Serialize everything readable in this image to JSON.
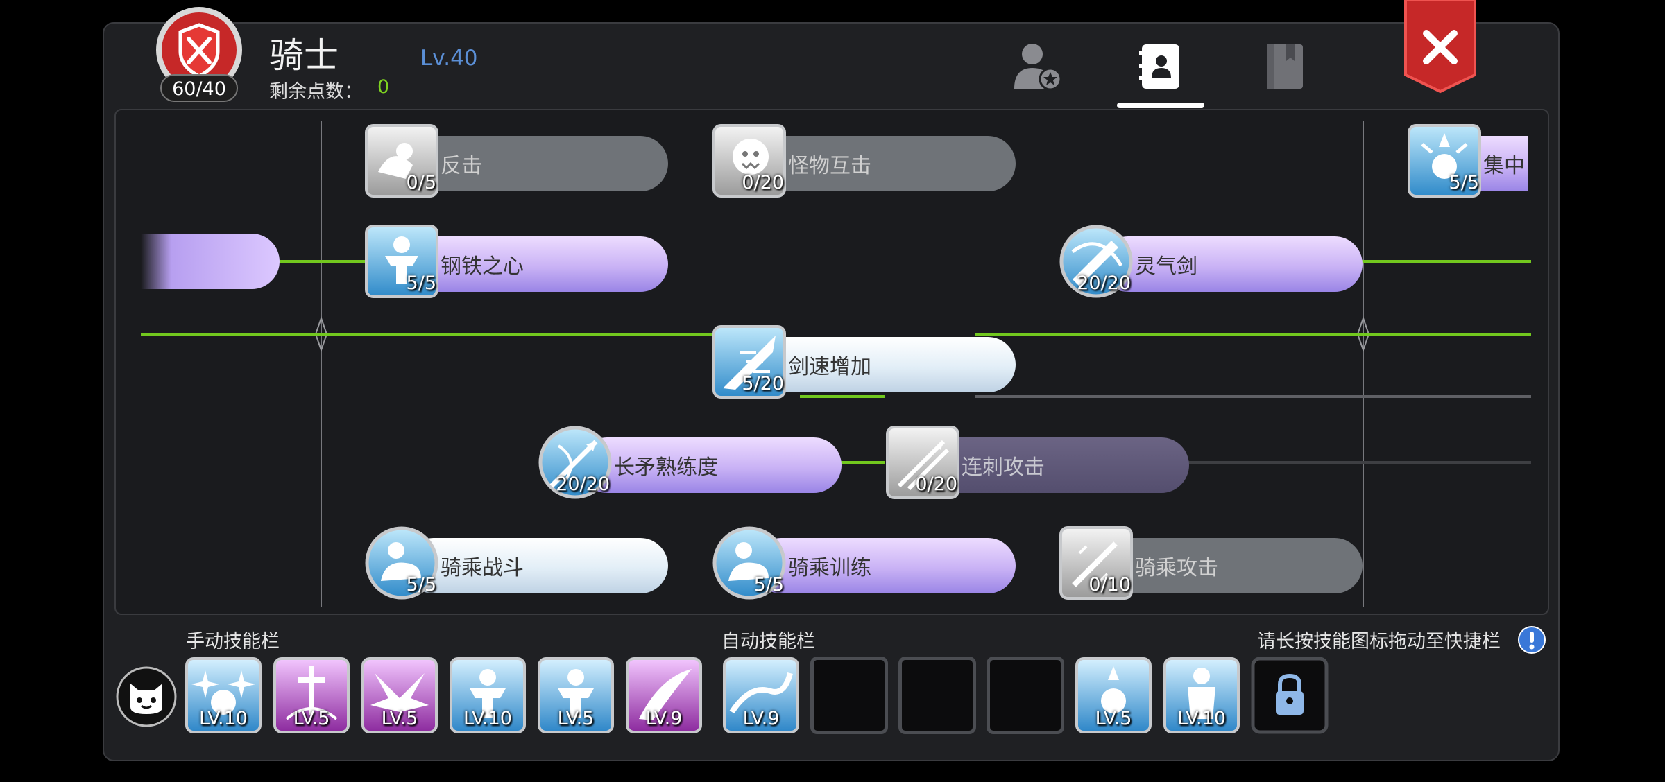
{
  "header": {
    "emblem_value": "60/40",
    "class_name": "骑士",
    "class_level": "Lv.40",
    "points_label": "剩余点数：",
    "points_value": "0",
    "tabs": [
      {
        "name": "character-tab",
        "icon": "person-star-icon",
        "active": false
      },
      {
        "name": "skills-tab",
        "icon": "contact-book-icon",
        "active": true
      },
      {
        "name": "guide-tab",
        "icon": "book-icon",
        "active": false
      }
    ],
    "close_icon": "close-icon"
  },
  "skills": [
    {
      "id": "counter",
      "name": "反击",
      "level": "0/5",
      "style": "gray",
      "icon": "counter-icon"
    },
    {
      "id": "monster",
      "name": "怪物互击",
      "level": "0/20",
      "style": "gray",
      "icon": "monster-icon"
    },
    {
      "id": "focus",
      "name": "集中",
      "level": "5/5",
      "style": "purple",
      "icon": "focus-icon"
    },
    {
      "id": "steel",
      "name": "钢铁之心",
      "level": "5/5",
      "style": "purple",
      "icon": "steel-heart-icon"
    },
    {
      "id": "aura",
      "name": "灵气剑",
      "level": "20/20",
      "style": "purple",
      "icon": "aura-sword-icon"
    },
    {
      "id": "swordspeed",
      "name": "剑速增加",
      "level": "5/20",
      "style": "white",
      "icon": "sword-speed-icon"
    },
    {
      "id": "spear",
      "name": "长矛熟练度",
      "level": "20/20",
      "style": "purple",
      "icon": "spear-mastery-icon"
    },
    {
      "id": "pierce",
      "name": "连刺攻击",
      "level": "0/20",
      "style": "dimpurple",
      "icon": "pierce-icon"
    },
    {
      "id": "ridefight",
      "name": "骑乘战斗",
      "level": "5/5",
      "style": "white",
      "icon": "riding-combat-icon"
    },
    {
      "id": "ridetrain",
      "name": "骑乘训练",
      "level": "5/5",
      "style": "purple",
      "icon": "riding-training-icon"
    },
    {
      "id": "rideattack",
      "name": "骑乘攻击",
      "level": "0/10",
      "style": "gray",
      "icon": "riding-attack-icon"
    }
  ],
  "bars": {
    "manual_label": "手动技能栏",
    "auto_label": "自动技能栏",
    "hint": "请长按技能图标拖动至快捷栏",
    "manual_slots": [
      {
        "level": "LV.10",
        "icon": "sparkle-orb-icon",
        "kind": "blue"
      },
      {
        "level": "LV.5",
        "icon": "holy-cross-icon",
        "kind": "pink"
      },
      {
        "level": "LV.5",
        "icon": "wing-burst-icon",
        "kind": "pink"
      },
      {
        "level": "LV.10",
        "icon": "strong-man-icon",
        "kind": "blue"
      },
      {
        "level": "LV.5",
        "icon": "strong-man-icon",
        "kind": "blue"
      },
      {
        "level": "LV.9",
        "icon": "feather-slash-icon",
        "kind": "pink"
      }
    ],
    "auto_slots": [
      {
        "level": "LV.9",
        "icon": "wave-slash-icon",
        "kind": "blue"
      },
      {
        "level": "",
        "icon": "",
        "kind": "empty"
      },
      {
        "level": "",
        "icon": "",
        "kind": "empty"
      },
      {
        "level": "",
        "icon": "",
        "kind": "empty"
      },
      {
        "level": "LV.5",
        "icon": "focus-icon",
        "kind": "blue"
      },
      {
        "level": "LV.10",
        "icon": "guardian-icon",
        "kind": "blue"
      },
      {
        "level": "",
        "icon": "lock-icon",
        "kind": "locked"
      }
    ]
  }
}
